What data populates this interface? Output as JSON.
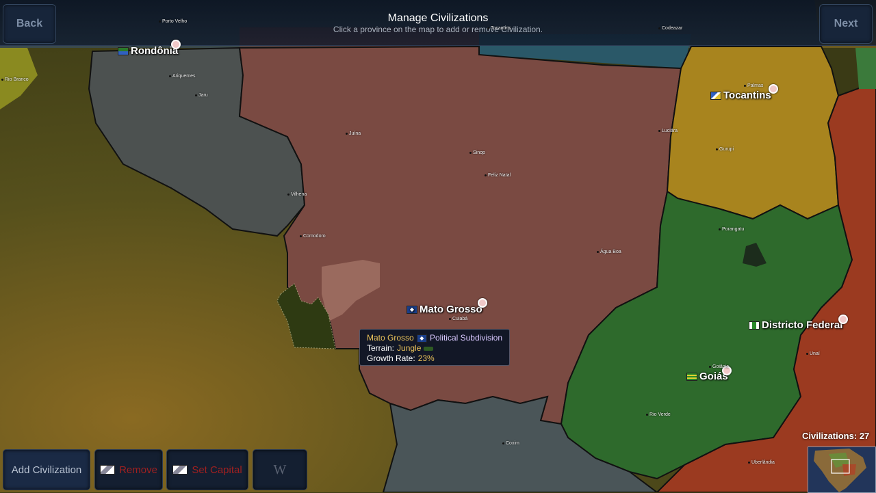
{
  "header": {
    "title": "Manage Civilizations",
    "subtitle": "Click a province on the map to add or remove Civilization.",
    "back_label": "Back",
    "next_label": "Next"
  },
  "regions": {
    "rondonia": "Rondônia",
    "tocantins": "Tocantins",
    "mato_grosso": "Mato Grosso",
    "distrito_federal": "Districto Federal",
    "goias": "Goiás"
  },
  "cities": {
    "porto_velho": "Porto Velho",
    "rio_branco": "Rio Branco",
    "ariquemes": "Ariquemes",
    "jaru": "Jaru",
    "vilhena": "Vilhena",
    "comodoro": "Comodoro",
    "juina": "Juína",
    "sinop": "Sinop",
    "feliz_natal": "Feliz Natal",
    "agua_boa": "Água Boa",
    "cuiaba": "Cuiabá",
    "coxim": "Coxim",
    "palmas": "Palmas",
    "luciara": "Luciára",
    "gurupi": "Gurupi",
    "porangatu": "Porangatu",
    "goiania": "Goiânia",
    "rio_verde": "Rio Verde",
    "unai": "Unaí",
    "uberlandia": "Uberlândia",
    "codeazar": "Codeazar",
    "tocantins_city": "Tocantins"
  },
  "tooltip": {
    "province": "Mato Grosso",
    "type": "Political Subdivision",
    "terrain_label": "Terrain:",
    "terrain_value": "Jungle",
    "growth_label": "Growth Rate:",
    "growth_value": "23%"
  },
  "toolbar": {
    "add_label": "Add Civilization",
    "remove_label": "Remove",
    "set_capital_label": "Set Capital"
  },
  "civilizations": {
    "label": "Civilizations:",
    "count": "27"
  },
  "colors": {
    "mato_grosso": "#7a4a42",
    "rondonia": "#4c5150",
    "tocantins": "#a8841e",
    "goias": "#2e6a2c",
    "south_region": "#4a5558",
    "red_region": "#9b3a20",
    "disabled_text": "#a02020",
    "accent_gold": "#e9c25a"
  }
}
